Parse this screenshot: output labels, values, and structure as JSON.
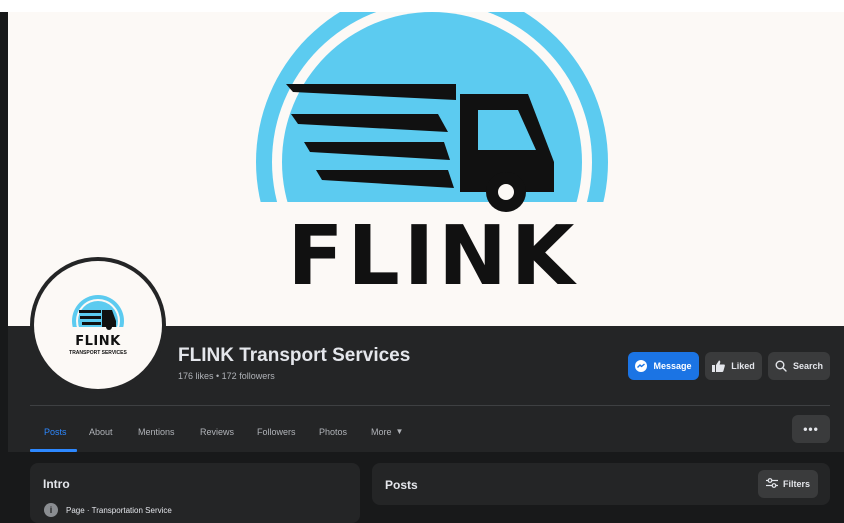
{
  "cover": {
    "brand_text": "FLINK",
    "colors": {
      "accent": "#5ccbf0",
      "ink": "#111111",
      "background": "#fcf9f6"
    }
  },
  "profile": {
    "avatar_brand": "FLINK",
    "avatar_tagline": "TRANSPORT SERVICES",
    "name": "FLINK Transport Services",
    "stats": "176 likes • 172 followers"
  },
  "actions": {
    "message_label": "Message",
    "liked_label": "Liked",
    "search_label": "Search"
  },
  "tabs": [
    {
      "label": "Posts",
      "active": true
    },
    {
      "label": "About"
    },
    {
      "label": "Mentions"
    },
    {
      "label": "Reviews"
    },
    {
      "label": "Followers"
    },
    {
      "label": "Photos"
    },
    {
      "label": "More"
    }
  ],
  "more_menu_label": "•••",
  "intro": {
    "title": "Intro",
    "category": "Page · Transportation Service"
  },
  "posts_section": {
    "title": "Posts",
    "filters_label": "Filters"
  },
  "theme": {
    "primary": "#1b74e4",
    "tab_active": "#2d88ff",
    "panel": "#242526",
    "page": "#18191a"
  }
}
